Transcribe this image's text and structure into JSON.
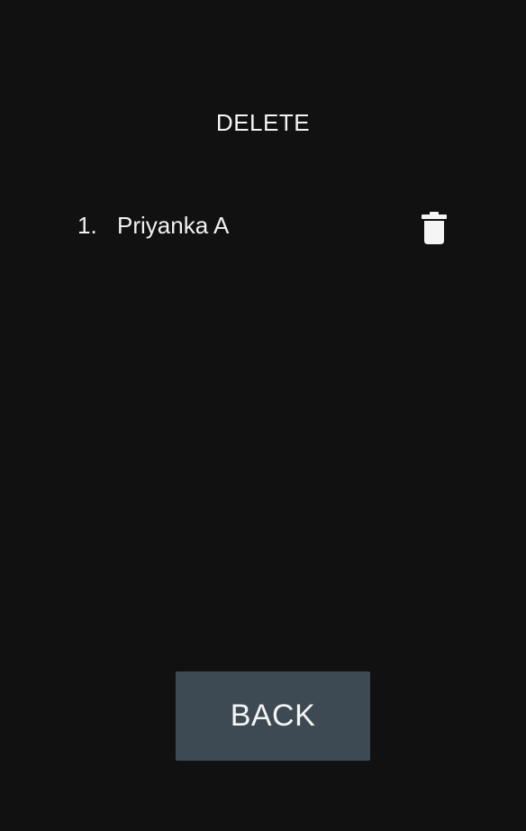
{
  "screen": {
    "title": "DELETE"
  },
  "list": {
    "items": [
      {
        "index": "1.",
        "name": "Priyanka A",
        "action_icon": "trash-icon"
      }
    ]
  },
  "footer": {
    "back_label": "BACK"
  },
  "colors": {
    "background": "#111112",
    "text": "#f2f2f2",
    "button_background": "#3d4a54"
  }
}
